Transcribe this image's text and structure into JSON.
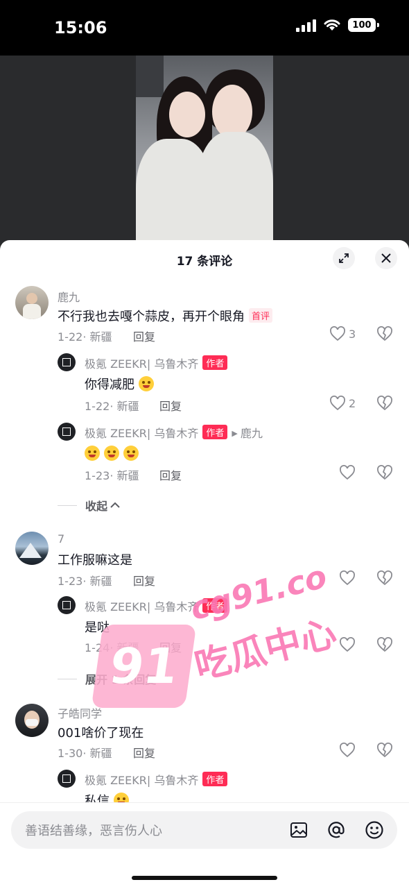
{
  "status_bar": {
    "time": "15:06",
    "battery": "100"
  },
  "sheet": {
    "title": "17 条评论"
  },
  "comments": [
    {
      "user": "鹿九",
      "text": "不行我也去嘎个蒜皮，再开个眼角",
      "badge": "首评",
      "date_loc": "1-22· 新疆",
      "reply_label": "回复",
      "likes": "3",
      "replies": [
        {
          "user": "极氪 ZEEKR| 乌鲁木齐",
          "tag": "作者",
          "text": "你得减肥",
          "date_loc": "1-22· 新疆",
          "reply_label": "回复",
          "likes": "2"
        },
        {
          "user": "极氪 ZEEKR| 乌鲁木齐",
          "tag": "作者",
          "reply_to": "鹿九",
          "text": "",
          "date_loc": "1-23· 新疆",
          "reply_label": "回复",
          "likes": ""
        }
      ],
      "fold_label": "收起"
    },
    {
      "user": "7",
      "text": "工作服嘛这是",
      "date_loc": "1-23· 新疆",
      "reply_label": "回复",
      "likes": "",
      "replies": [
        {
          "user": "极氪 ZEEKR| 乌鲁木齐",
          "tag": "作者",
          "text": "是哒",
          "date_loc": "1-24· 新疆",
          "reply_label": "回复",
          "likes": ""
        }
      ],
      "fold_label": "展开 1 条回复"
    },
    {
      "user": "子皓同学",
      "text": "001啥价了现在",
      "date_loc": "1-30· 新疆",
      "reply_label": "回复",
      "likes": "",
      "replies": [
        {
          "user": "极氪 ZEEKR| 乌鲁木齐",
          "tag": "作者",
          "text": "私信"
        }
      ]
    }
  ],
  "watermark": {
    "number": "91",
    "url": "cg91.co",
    "name": "吃瓜中心"
  },
  "input": {
    "placeholder": "善语结善缘，恶言伤人心"
  },
  "colors": {
    "accent": "#fe2c55",
    "muted": "#8a8b91"
  }
}
